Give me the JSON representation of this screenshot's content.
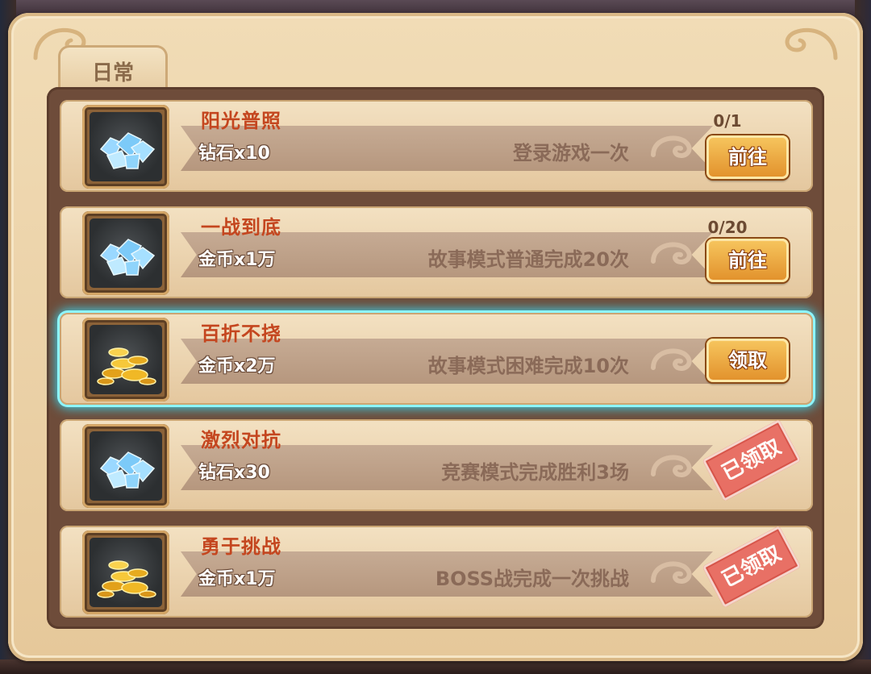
{
  "tabs": [
    {
      "label": "日常",
      "active": true
    }
  ],
  "tasks": [
    {
      "title": "阳光普照",
      "reward": "钻石x10",
      "description": "登录游戏一次",
      "progress": "0/1",
      "action": "前往",
      "icon": "diamond-icon",
      "status": "go"
    },
    {
      "title": "一战到底",
      "reward": "金币x1万",
      "description": "故事模式普通完成20次",
      "progress": "0/20",
      "action": "前往",
      "icon": "diamond-icon",
      "status": "go"
    },
    {
      "title": "百折不挠",
      "reward": "金币x2万",
      "description": "故事模式困难完成10次",
      "progress": "",
      "action": "领取",
      "icon": "gold-coin-icon",
      "status": "claimable"
    },
    {
      "title": "激烈对抗",
      "reward": "钻石x30",
      "description": "竞赛模式完成胜利3场",
      "progress": "",
      "action": "已领取",
      "icon": "diamond-icon",
      "status": "claimed"
    },
    {
      "title": "勇于挑战",
      "reward": "金币x1万",
      "description": "BOSS战完成一次挑战",
      "progress": "",
      "action": "已领取",
      "icon": "gold-coin-icon",
      "status": "claimed"
    }
  ],
  "colors": {
    "title_red": "#c4461f",
    "button_orange": "#e18f2a",
    "stamp_red": "#e8685f",
    "highlight_cyan": "#38d6f0"
  }
}
